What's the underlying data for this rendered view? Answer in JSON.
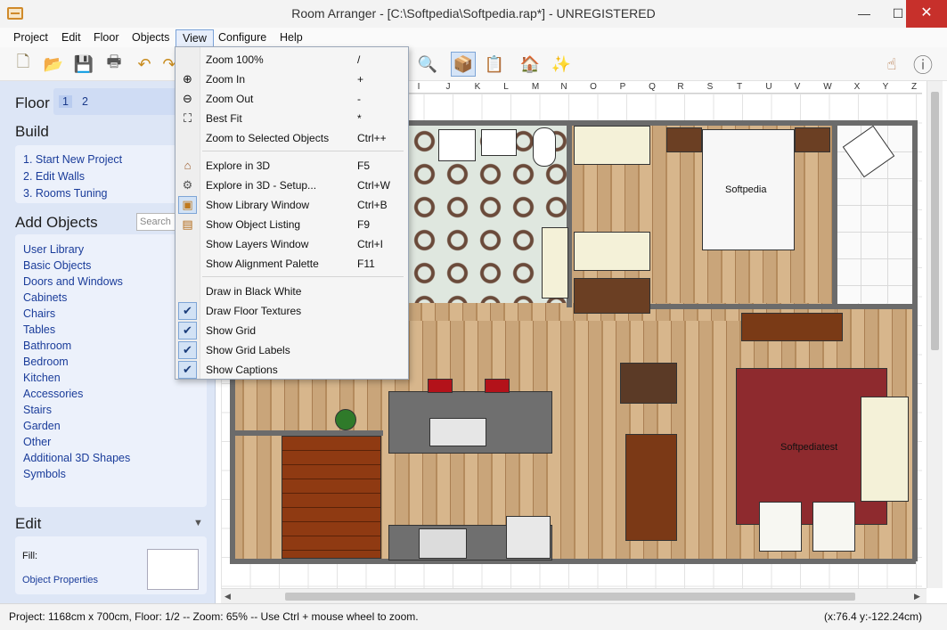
{
  "window": {
    "title": "Room Arranger - [C:\\Softpedia\\Softpedia.rap*] - UNREGISTERED",
    "min": "—",
    "max": "☐",
    "close": "✕"
  },
  "menu": {
    "project": "Project",
    "edit": "Edit",
    "floor": "Floor",
    "objects": "Objects",
    "view": "View",
    "configure": "Configure",
    "help": "Help"
  },
  "left": {
    "floor_title": "Floor",
    "floor_1": "1",
    "floor_2": "2",
    "build_title": "Build",
    "build_items": [
      "1. Start New Project",
      "2. Edit Walls",
      "3. Rooms Tuning"
    ],
    "add_title": "Add Objects",
    "search_placeholder": "Search",
    "categories": [
      "User Library",
      "Basic Objects",
      "Doors and Windows",
      "Cabinets",
      "Chairs",
      "Tables",
      "Bathroom",
      "Bedroom",
      "Kitchen",
      "Accessories",
      "Stairs",
      "Garden",
      "Other",
      "Additional 3D Shapes",
      "Symbols"
    ],
    "edit_title": "Edit",
    "edit_collapse": "▼",
    "fill_label": "Fill:",
    "object_properties": "Object Properties"
  },
  "ruler_labels": [
    "I",
    "J",
    "K",
    "L",
    "M",
    "N",
    "O",
    "P",
    "Q",
    "R",
    "S",
    "T",
    "U",
    "V",
    "W",
    "X",
    "Y",
    "Z"
  ],
  "view_menu": {
    "zoom100": {
      "label": "Zoom 100%",
      "shortcut": "/"
    },
    "zoomin": {
      "label": "Zoom In",
      "shortcut": "+"
    },
    "zoomout": {
      "label": "Zoom Out",
      "shortcut": "-"
    },
    "bestfit": {
      "label": "Best Fit",
      "shortcut": "*"
    },
    "zoomsel": {
      "label": "Zoom to Selected Objects",
      "shortcut": "Ctrl++"
    },
    "explore3d": {
      "label": "Explore in 3D",
      "shortcut": "F5"
    },
    "explore3dsetup": {
      "label": "Explore in 3D - Setup...",
      "shortcut": "Ctrl+W"
    },
    "library": {
      "label": "Show Library Window",
      "shortcut": "Ctrl+B"
    },
    "listing": {
      "label": "Show Object Listing",
      "shortcut": "F9"
    },
    "layers": {
      "label": "Show Layers Window",
      "shortcut": "Ctrl+I"
    },
    "alignment": {
      "label": "Show Alignment Palette",
      "shortcut": "F11"
    },
    "blackwhite": {
      "label": "Draw in Black  White"
    },
    "floortextures": {
      "label": "Draw Floor Textures"
    },
    "showgrid": {
      "label": "Show Grid"
    },
    "gridlabels": {
      "label": "Show Grid Labels"
    },
    "captions": {
      "label": "Show Captions"
    },
    "check": "✔"
  },
  "plan_captions": {
    "bedroom": "Softpedia",
    "living": "Softpediatest"
  },
  "status": {
    "left": "Project: 1168cm x 700cm, Floor: 1/2 -- Zoom: 65% -- Use Ctrl + mouse wheel to zoom.",
    "right": "(x:76.4 y:-122.24cm)"
  },
  "icons": {
    "new": "🗋",
    "open": "📂",
    "save": "💾",
    "print": "🖶",
    "undo": "↶",
    "redo": "↷",
    "zoomout": "🔍",
    "box": "📦",
    "list": "📋",
    "house": "🏠",
    "wand": "✨",
    "hand": "☝",
    "info": "ⓘ"
  }
}
